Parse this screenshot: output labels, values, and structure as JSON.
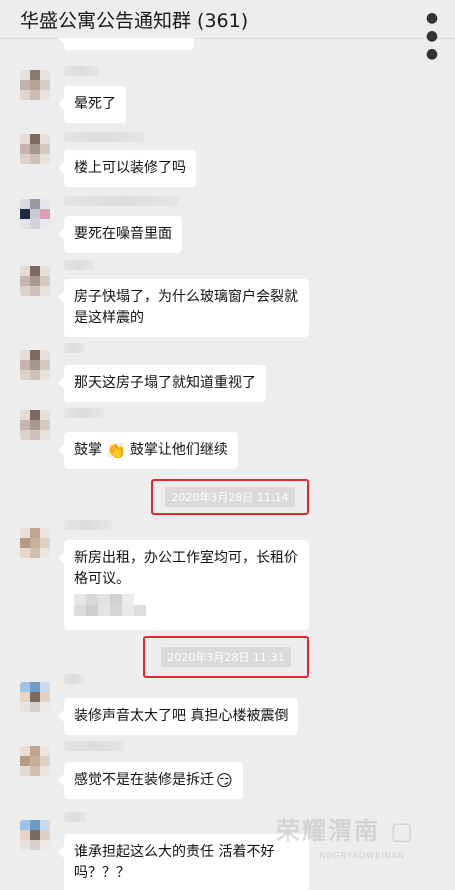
{
  "header": {
    "title": "华盛公寓公告通知群 (361)",
    "more_icon": "ellipsis-icon"
  },
  "messages": [
    {
      "text": "晕死了"
    },
    {
      "text": "楼上可以装修了吗"
    },
    {
      "text": "要死在噪音里面"
    },
    {
      "text": "房子快塌了，为什么玻璃窗户会裂就是这样震的"
    },
    {
      "text": "那天这房子塌了就知道重视了"
    },
    {
      "text_a": "鼓掌",
      "emoji_icon": "clapping-hands-icon",
      "text_b": "鼓掌让他们继续"
    },
    {
      "text": "新房出租，办公工作室均可，长租价格可议。"
    },
    {
      "text": "装修声音太大了吧   真担心楼被震倒"
    },
    {
      "text": "感觉不是在装修是拆迁",
      "emoji_icon": "smirk-face-icon"
    },
    {
      "text": "谁承担起这么大的责任 活着不好吗？？？"
    }
  ],
  "timestamps": [
    {
      "text": "2020年3月28日 11:14"
    },
    {
      "text": "2020年3月28日 11:31"
    }
  ],
  "colors": {
    "background": "#ededed",
    "bubble": "#ffffff",
    "highlight": "#e0282e",
    "timestamp_bg": "#dadada"
  }
}
